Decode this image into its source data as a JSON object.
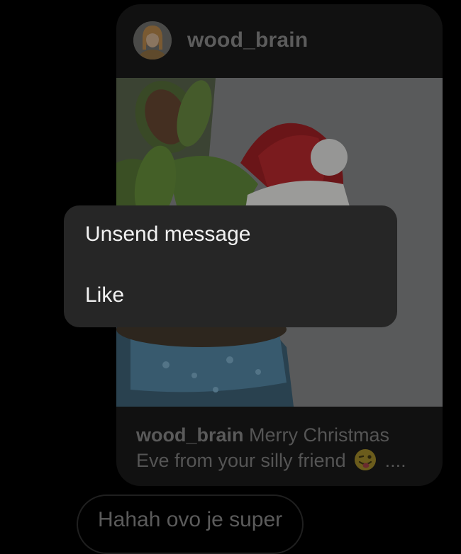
{
  "post": {
    "username": "wood_brain",
    "caption_user": "wood_brain",
    "caption_text": "Merry Christmas Eve from your silly friend",
    "caption_more": "....",
    "emoji_icon": "winking-tongue-face-icon"
  },
  "context_menu": {
    "items": [
      {
        "label": "Unsend message"
      },
      {
        "label": "Like"
      }
    ]
  },
  "reply": {
    "text": "Hahah ovo je super"
  },
  "colors": {
    "background": "#000000",
    "card": "#111111",
    "menu": "#262626",
    "menu_text": "#f2f2f2",
    "dimmed_text": "#5c5c5c"
  }
}
